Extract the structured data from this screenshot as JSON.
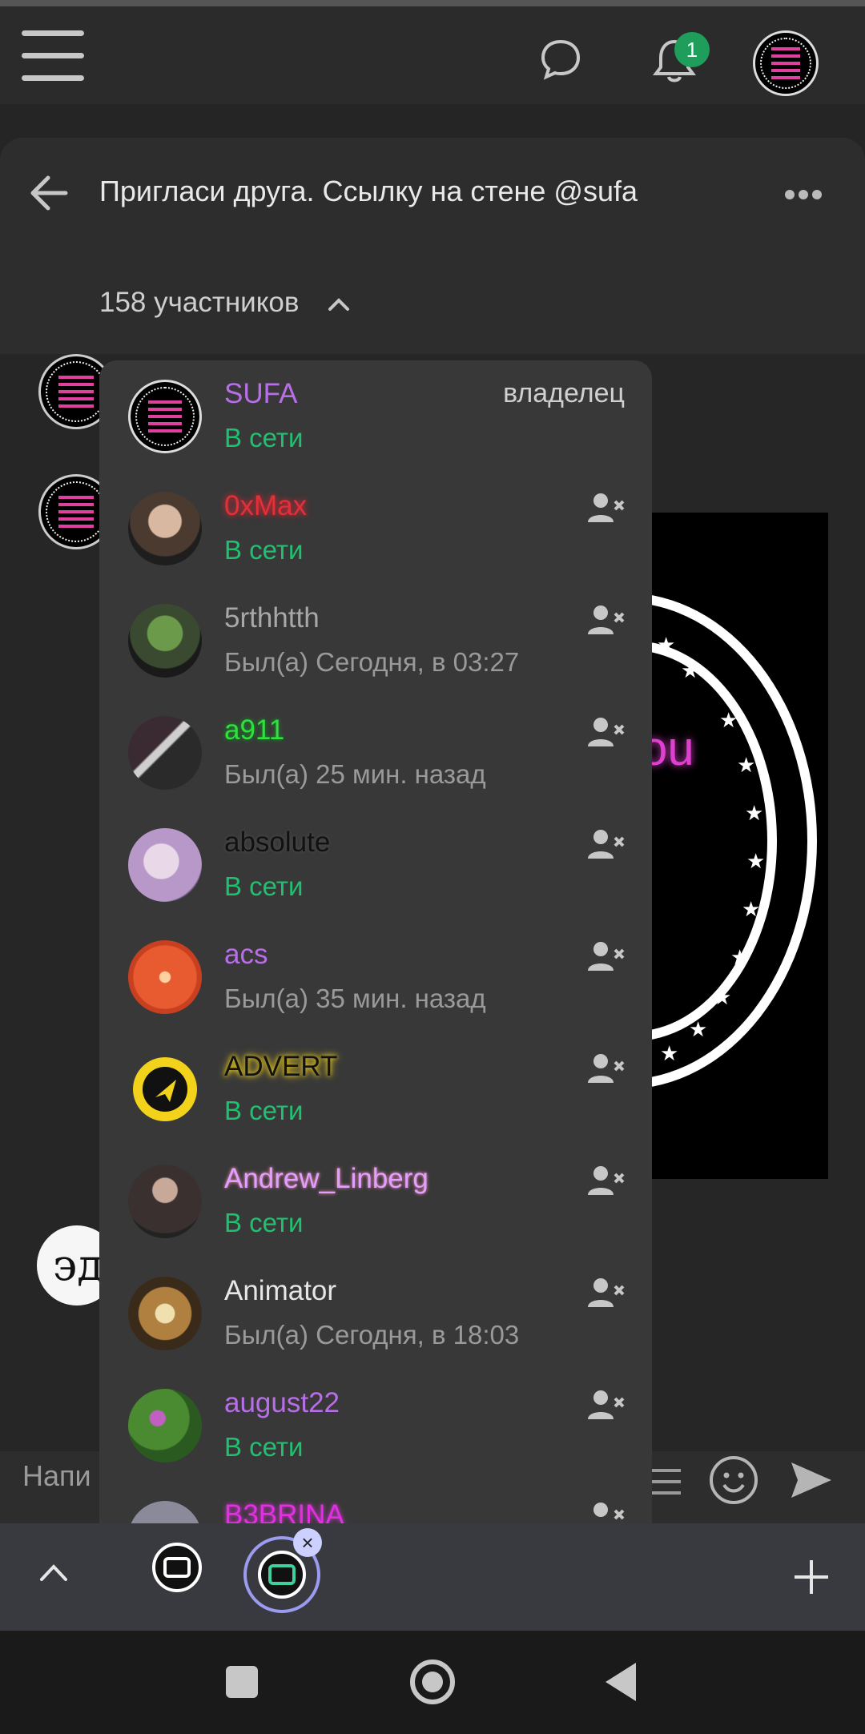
{
  "topbar": {
    "notification_count": "1",
    "icons": [
      "menu-icon",
      "chat-bubble-icon",
      "bell-icon",
      "avatar"
    ]
  },
  "chat": {
    "title": "Пригласи друга. Ссылку на стене @sufa",
    "members_count": "158 участников",
    "compose_placeholder": "Напи"
  },
  "members": [
    {
      "name": "SUFA",
      "status": "В сети",
      "role": "владелец",
      "name_color": "#b86ee8",
      "status_color": "#20c070"
    },
    {
      "name": "0xMax",
      "status": "В сети",
      "role": "",
      "name_color": "#e0303a",
      "status_color": "#20c070"
    },
    {
      "name": "5rthhtth",
      "status": "Был(а) Сегодня, в 03:27",
      "role": "",
      "name_color": "#a8a8a8",
      "status_color": "#9a9a9a"
    },
    {
      "name": "a911",
      "status": "Был(а) 25 мин. назад",
      "role": "",
      "name_color": "#30e040",
      "status_color": "#9a9a9a"
    },
    {
      "name": "absolute",
      "status": "В сети",
      "role": "",
      "name_color": "#111111",
      "status_color": "#20c070"
    },
    {
      "name": "acs",
      "status": "Был(а) 35 мин. назад",
      "role": "",
      "name_color": "#b86ee8",
      "status_color": "#9a9a9a"
    },
    {
      "name": "ADVERT",
      "status": "В сети",
      "role": "",
      "name_color": "#111111",
      "status_color": "#20c070"
    },
    {
      "name": "Andrew_Linberg",
      "status": "В сети",
      "role": "",
      "name_color": "#e0a0ff",
      "status_color": "#20c070"
    },
    {
      "name": "Animator",
      "status": "Был(а) Сегодня, в 18:03",
      "role": "",
      "name_color": "#e6e6e6",
      "status_color": "#9a9a9a"
    },
    {
      "name": "august22",
      "status": "В сети",
      "role": "",
      "name_color": "#b86ee8",
      "status_color": "#20c070"
    },
    {
      "name": "B3BRINA",
      "status": "",
      "role": "",
      "name_color": "#e030e0",
      "status_color": "#9a9a9a"
    }
  ],
  "colors": {
    "online": "#20c070",
    "accent": "#9b9bf0"
  }
}
